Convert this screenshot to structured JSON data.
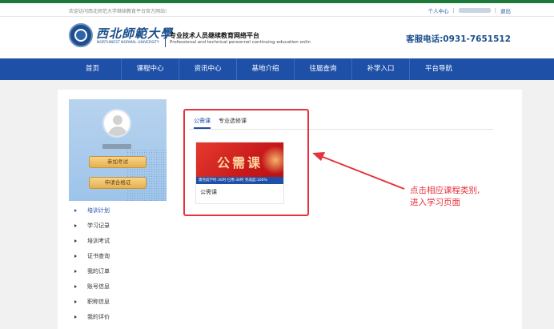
{
  "topbar": {
    "welcome": "欢迎访问西北师范大学继续教育平台官方网站!",
    "personal_center": "个人中心",
    "separator": "|",
    "logout": "退出"
  },
  "header": {
    "logo_cn": "西北師範大學",
    "logo_en": "NORTHWEST NORMAL UNIVERSITY",
    "platform_cn": "专业技术人员继续教育网络平台",
    "platform_en": "Professional and technical personnel continuing education onlin",
    "hotline": "客服电话:0931-7651512"
  },
  "nav": {
    "items": [
      {
        "label": "首页"
      },
      {
        "label": "课程中心"
      },
      {
        "label": "资讯中心"
      },
      {
        "label": "基地介绍"
      },
      {
        "label": "往届查询"
      },
      {
        "label": "补学入口"
      },
      {
        "label": "平台导航"
      }
    ]
  },
  "sidebar": {
    "exam_button": "参加考试",
    "cert_button": "申请合格证",
    "menu": [
      {
        "label": "培训计划",
        "active": true
      },
      {
        "label": "学习记录",
        "active": false
      },
      {
        "label": "培训考试",
        "active": false
      },
      {
        "label": "证书查询",
        "active": false
      },
      {
        "label": "我的订单",
        "active": false
      },
      {
        "label": "账号信息",
        "active": false
      },
      {
        "label": "职称信息",
        "active": false
      },
      {
        "label": "我的评价",
        "active": false
      }
    ]
  },
  "main": {
    "tabs": [
      {
        "label": "公需课",
        "active": true
      },
      {
        "label": "专业选修课",
        "active": false
      }
    ],
    "course": {
      "banner_title": "公需课",
      "progress_strip": "需完成学时:30时 已用:30时 完成度:100%",
      "name": "公需课"
    }
  },
  "annotation": {
    "line1": "点击相应课程类别,",
    "line2": "进入学习页面"
  },
  "colors": {
    "nav_blue": "#1e50a8",
    "annotation_red": "#e5323b",
    "button_gold": "#e5b04f"
  }
}
